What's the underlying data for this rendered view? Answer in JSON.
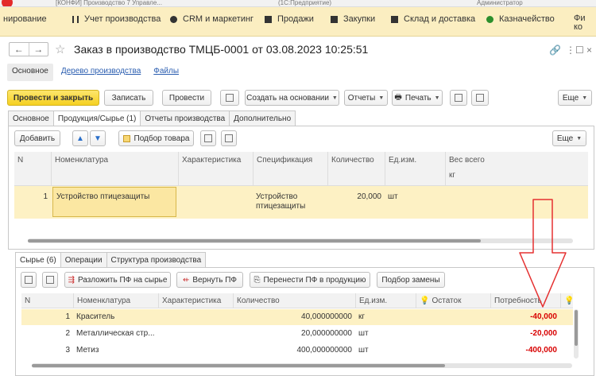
{
  "app": {
    "title_fragments": [
      "[КОНФИ] Производство 7 Управле...",
      "(1С:Предприятие)",
      "Администратор"
    ]
  },
  "sections": [
    {
      "label": "нирование",
      "icon": "none"
    },
    {
      "label": "Учет производства",
      "icon": "factory-icon"
    },
    {
      "label": "CRM и маркетинг",
      "icon": "crm-icon"
    },
    {
      "label": "Продажи",
      "icon": "sales-icon"
    },
    {
      "label": "Закупки",
      "icon": "purchases-icon"
    },
    {
      "label": "Склад и доставка",
      "icon": "warehouse-icon"
    },
    {
      "label": "Казначейство",
      "icon": "treasury-icon"
    },
    {
      "label": "Фи",
      "label2": "ко",
      "icon": "finance-icon"
    }
  ],
  "form": {
    "title": "Заказ в производство ТМЦБ-0001 от 03.08.2023 10:25:51",
    "nav_back": "←",
    "nav_forward": "→",
    "tabs": [
      "Основное",
      "Дерево производства",
      "Файлы"
    ]
  },
  "commands": {
    "post_close": "Провести и закрыть",
    "write": "Записать",
    "post": "Провести",
    "create_based_on": "Создать на основании",
    "reports": "Отчеты",
    "print": "Печать",
    "more": "Еще"
  },
  "doc_tabs": [
    "Основное",
    "Продукция/Сырье (1)",
    "Отчеты производства",
    "Дополнительно"
  ],
  "products": {
    "add": "Добавить",
    "select_goods": "Подбор товара",
    "more": "Еще",
    "columns": [
      "N",
      "Номенклатура",
      "Характеристика",
      "Спецификация",
      "Количество",
      "Ед.изм.",
      "Вес всего"
    ],
    "weight_unit": "кг",
    "rows": [
      {
        "n": "1",
        "item": "Устройство птицезащиты",
        "spec1": "Устройство",
        "spec2": "птицезащиты",
        "qty": "20,000",
        "unit": "шт"
      }
    ]
  },
  "bottom_tabs": [
    "Сырье (6)",
    "Операции",
    "Структура производства"
  ],
  "materials": {
    "expand_pf": "Разложить ПФ на сырье",
    "return_pf": "Вернуть ПФ",
    "move_pf": "Перенести ПФ в продукцию",
    "replace": "Подбор замены",
    "columns": [
      "N",
      "Номенклатура",
      "Характеристика",
      "Количество",
      "Ед.изм.",
      "Остаток",
      "Потребность"
    ],
    "rows": [
      {
        "n": "1",
        "item": "Краситель",
        "qty": "40,000000000",
        "unit": "кг",
        "need": "-40,000"
      },
      {
        "n": "2",
        "item": "Металлическая стр...",
        "qty": "20,000000000",
        "unit": "шт",
        "need": "-20,000"
      },
      {
        "n": "3",
        "item": "Метиз",
        "qty": "400,000000000",
        "unit": "шт",
        "need": "-400,000"
      }
    ]
  },
  "colors": {
    "section_bg": "#fbeec1",
    "primary_button": "#f5d021",
    "selected_row": "#fdf1c4",
    "negative": "#d80000",
    "arrow": "#e53030"
  }
}
